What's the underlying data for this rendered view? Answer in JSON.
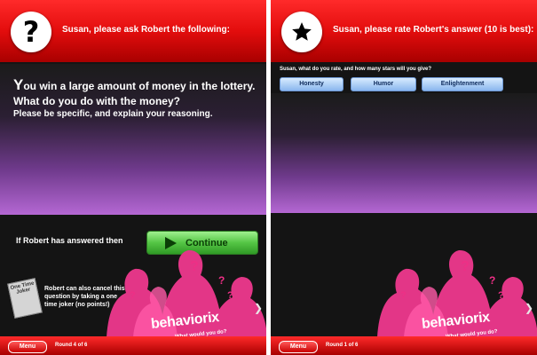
{
  "left_screen": {
    "header_icon": "question-mark",
    "header_text": "Susan, please ask Robert the following:",
    "question_first_letter": "Y",
    "question_line1_rest": "ou win a large amount of money in the lottery.",
    "question_line2": "What do you do with the money?",
    "question_line3": "Please be specific, and explain your reasoning.",
    "answered_label": "If Robert has answered then",
    "continue_label": "Continue",
    "joker_card_label": "One Time Joker",
    "joker_text": "Robert can also cancel this question by taking a one time joker (no points!)",
    "brand": "behaviorix",
    "tagline": "What would you do?",
    "menu_label": "Menu",
    "round_label": "Round 4 of 6"
  },
  "right_screen": {
    "header_icon": "star",
    "header_text": "Susan, please rate Robert's answer (10 is best):",
    "rate_prompt": "Susan, what do you rate, and how many stars will you give?",
    "rate_buttons": [
      "Honesty",
      "Humor",
      "Enlightenment"
    ],
    "brand": "behaviorix",
    "tagline": "What would you do?",
    "menu_label": "Menu",
    "round_label": "Round 1 of 6"
  },
  "colors": {
    "header_red": "#e30d0d",
    "continue_green": "#55c545",
    "rate_blue": "#8ab6ee",
    "panel_purple": "#b467d3",
    "figure_pink": "#ee2f86"
  }
}
